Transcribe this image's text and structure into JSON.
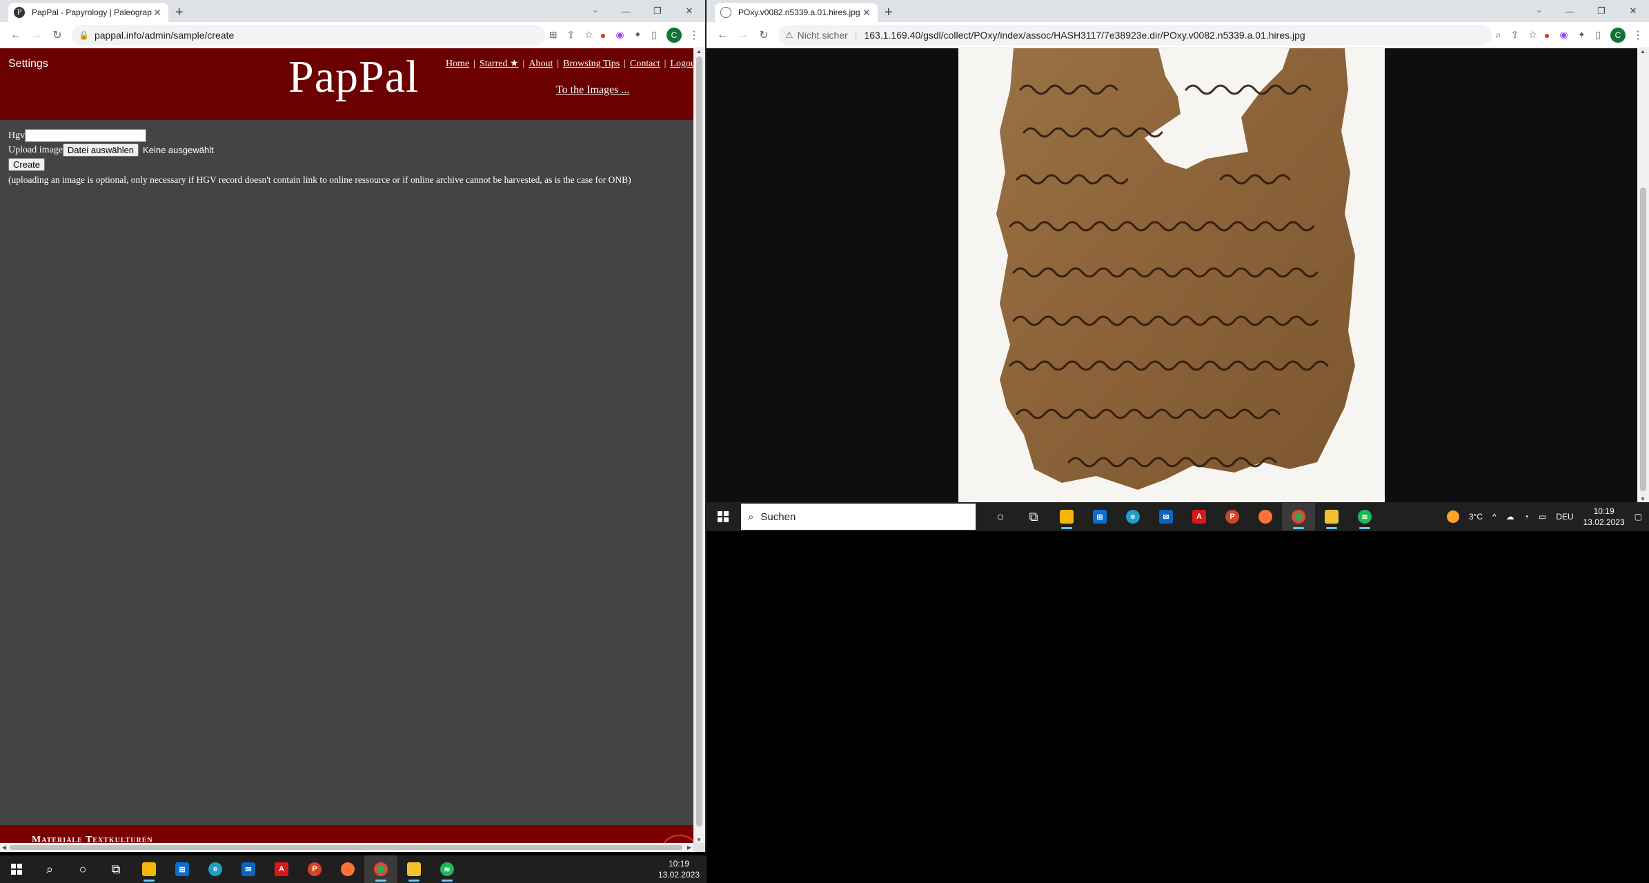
{
  "left_window": {
    "tab": {
      "favicon": "pappal-icon",
      "title": "PapPal - Papyrology | Paleograph"
    },
    "omnibox": {
      "url": "pappal.info/admin/sample/create"
    },
    "page": {
      "settings": "Settings",
      "logo": "PapPal",
      "nav": [
        "Home",
        "Starred ★",
        "About",
        "Browsing Tips",
        "Contact",
        "Logou"
      ],
      "to_images": "To the Images ...",
      "form": {
        "hgv_label": "Hgv",
        "hgv_value": "",
        "upload_label": "Upload image",
        "file_button": "Datei auswählen",
        "file_status": "Keine ausgewählt",
        "create_button": "Create",
        "note": "(uploading an image is optional, only necessary if HGV record doesn't contain link to online ressource or if online archive cannot be harvested, as is the case for ONB)"
      },
      "footer_text": "Materiale Textkulturen"
    }
  },
  "right_window": {
    "tab": {
      "favicon": "globe-icon",
      "title": "POxy.v0082.n5339.a.01.hires.jpg"
    },
    "omnibox": {
      "security": "Nicht sicher",
      "url": "163.1.169.40/gsdl/collect/POxy/index/assoc/HASH3117/7e38923e.dir/POxy.v0082.n5339.a.01.hires.jpg"
    },
    "image_alt": "papyrus fragment"
  },
  "taskbar_main": {
    "time": "10:19",
    "date": "13.02.2023",
    "apps": [
      "file-explorer",
      "store",
      "edge",
      "mail",
      "acrobat",
      "powerpoint",
      "firefox",
      "chrome",
      "file-manager",
      "spotify"
    ]
  },
  "taskbar_sub": {
    "search_placeholder": "Suchen",
    "weather": "3°C",
    "language": "DEU",
    "time": "10:19",
    "date": "13.02.2023"
  },
  "colors": {
    "header_red": "#6b0000",
    "page_bg": "#444444",
    "chrome_tab_bg": "#dee1e6"
  }
}
